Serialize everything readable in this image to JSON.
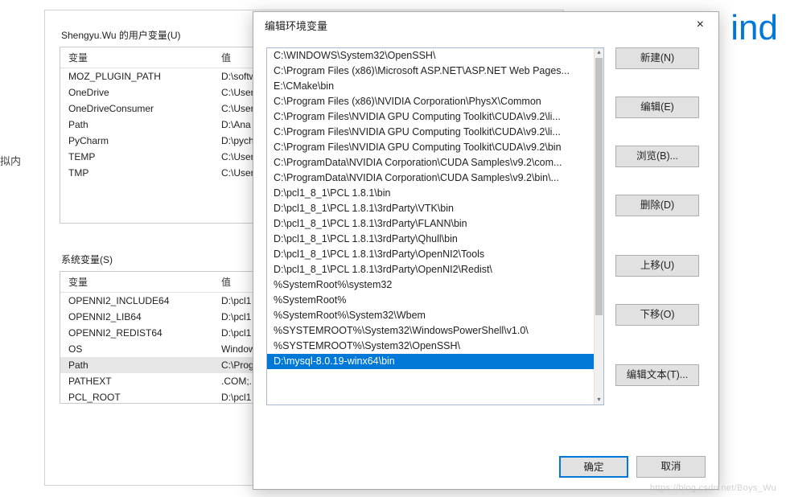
{
  "bg_text": "ind",
  "left_label": "拟内",
  "env_dialog": {
    "user_section_label": "Shengyu.Wu 的用户变量(U)",
    "col_var": "变量",
    "col_val": "值",
    "user_vars": [
      {
        "name": "MOZ_PLUGIN_PATH",
        "val": "D:\\softw"
      },
      {
        "name": "OneDrive",
        "val": "C:\\User"
      },
      {
        "name": "OneDriveConsumer",
        "val": "C:\\User"
      },
      {
        "name": "Path",
        "val": "D:\\Ana"
      },
      {
        "name": "PyCharm",
        "val": "D:\\pych"
      },
      {
        "name": "TEMP",
        "val": "C:\\User"
      },
      {
        "name": "TMP",
        "val": "C:\\User"
      }
    ],
    "sys_section_label": "系统变量(S)",
    "sys_vars": [
      {
        "name": "OPENNI2_INCLUDE64",
        "val": "D:\\pcl1"
      },
      {
        "name": "OPENNI2_LIB64",
        "val": "D:\\pcl1"
      },
      {
        "name": "OPENNI2_REDIST64",
        "val": "D:\\pcl1"
      },
      {
        "name": "OS",
        "val": "Window"
      },
      {
        "name": "Path",
        "val": "C:\\Prog",
        "selected": true
      },
      {
        "name": "PATHEXT",
        "val": ".COM;.E"
      },
      {
        "name": "PCL_ROOT",
        "val": "D:\\pcl1"
      }
    ]
  },
  "edit_dialog": {
    "title": "编辑环境变量",
    "close": "×",
    "paths": [
      "C:\\WINDOWS\\System32\\OpenSSH\\",
      "C:\\Program Files (x86)\\Microsoft ASP.NET\\ASP.NET Web Pages...",
      "E:\\CMake\\bin",
      "C:\\Program Files (x86)\\NVIDIA Corporation\\PhysX\\Common",
      "C:\\Program Files\\NVIDIA GPU Computing Toolkit\\CUDA\\v9.2\\li...",
      "C:\\Program Files\\NVIDIA GPU Computing Toolkit\\CUDA\\v9.2\\li...",
      "C:\\Program Files\\NVIDIA GPU Computing Toolkit\\CUDA\\v9.2\\bin",
      "C:\\ProgramData\\NVIDIA Corporation\\CUDA Samples\\v9.2\\com...",
      "C:\\ProgramData\\NVIDIA Corporation\\CUDA Samples\\v9.2\\bin\\...",
      "D:\\pcl1_8_1\\PCL 1.8.1\\bin",
      "D:\\pcl1_8_1\\PCL 1.8.1\\3rdParty\\VTK\\bin",
      "D:\\pcl1_8_1\\PCL 1.8.1\\3rdParty\\FLANN\\bin",
      "D:\\pcl1_8_1\\PCL 1.8.1\\3rdParty\\Qhull\\bin",
      "D:\\pcl1_8_1\\PCL 1.8.1\\3rdParty\\OpenNI2\\Tools",
      "D:\\pcl1_8_1\\PCL 1.8.1\\3rdParty\\OpenNI2\\Redist\\",
      "%SystemRoot%\\system32",
      "%SystemRoot%",
      "%SystemRoot%\\System32\\Wbem",
      "%SYSTEMROOT%\\System32\\WindowsPowerShell\\v1.0\\",
      "%SYSTEMROOT%\\System32\\OpenSSH\\",
      "D:\\mysql-8.0.19-winx64\\bin"
    ],
    "selected_index": 20,
    "buttons": {
      "new": "新建(N)",
      "edit": "编辑(E)",
      "browse": "浏览(B)...",
      "delete": "删除(D)",
      "moveup": "上移(U)",
      "movedown": "下移(O)",
      "edittext": "编辑文本(T)...",
      "ok": "确定",
      "cancel": "取消"
    }
  },
  "watermark": "https://blog.csdn.net/Boys_Wu"
}
